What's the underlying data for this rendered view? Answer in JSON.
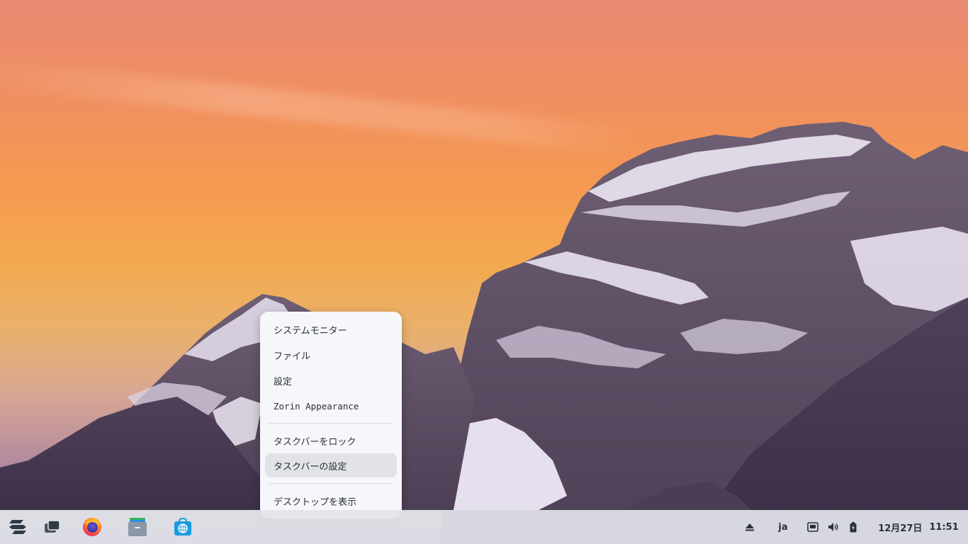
{
  "context_menu": {
    "items": [
      {
        "label": "システムモニター"
      },
      {
        "label": "ファイル"
      },
      {
        "label": "設定"
      },
      {
        "label": "Zorin Appearance"
      },
      {
        "label": "タスクバーをロック"
      },
      {
        "label": "タスクバーの設定",
        "highlighted": true
      },
      {
        "label": "デスクトップを表示"
      }
    ]
  },
  "taskbar": {
    "launchers": [
      {
        "icon": "zorin-menu-icon"
      },
      {
        "icon": "workspaces-icon"
      },
      {
        "icon": "firefox-icon"
      },
      {
        "icon": "files-icon"
      },
      {
        "icon": "software-store-icon"
      }
    ],
    "tray": {
      "input_method": "ja",
      "date": "12月27日",
      "time": "11:51"
    }
  },
  "colors": {
    "taskbar_bg": "#e2e4ea",
    "menu_bg": "#f6f7fa",
    "menu_hover": "#e1e3e8",
    "text": "#2b2f36",
    "accent_blue": "#1a9be0"
  }
}
